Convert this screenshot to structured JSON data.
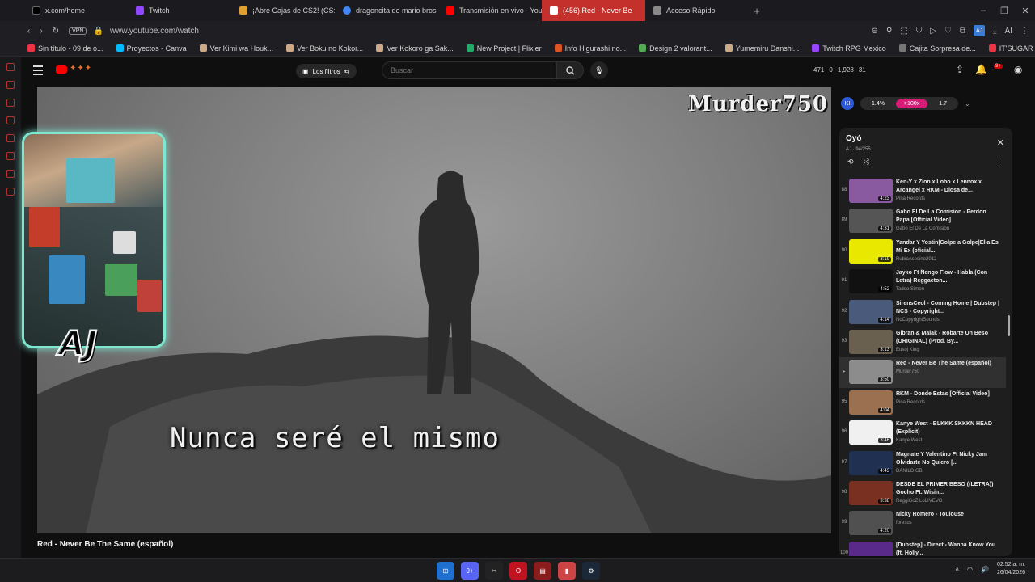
{
  "browser": {
    "tabs": [
      {
        "label": "x.com/home",
        "color": "#000000"
      },
      {
        "label": "Twitch",
        "color": "#9146ff"
      },
      {
        "label": "¡Abre Cajas de CS2! (CS:G",
        "color": "#e0a030"
      },
      {
        "label": "dragoncita de mario bros",
        "color": "#4285f4"
      },
      {
        "label": "Transmisión en vivo - You",
        "color": "#ff0000"
      },
      {
        "label": "(456) Red - Never Be",
        "color": "#ff0000"
      },
      {
        "label": "Acceso Rápido",
        "color": "#888888"
      }
    ],
    "new_tab": "+",
    "url": "www.youtube.com/watch",
    "vpn": "VPN",
    "profile_initials": "AJ",
    "ai_label": "AI",
    "bookmarks": [
      "Sin título - 09 de o...",
      "Proyectos - Canva",
      "Ver Kimi wa Houk...",
      "Ver Boku no Kokor...",
      "Ver Kokoro ga Sak...",
      "New Project | Flixier",
      "Info Higurashi no...",
      "Design 2 valorant...",
      "Yumemiru Danshi...",
      "Twitch RPG Mexico",
      "Cajita Sorpresa de...",
      "IT'SUGAR | Giant..."
    ]
  },
  "youtube": {
    "filter_label": "Los filtros",
    "search_placeholder": "Buscar",
    "stats": {
      "a": "471",
      "b": "0",
      "c": "1,928",
      "d": "31"
    },
    "notif_count": "9+",
    "video": {
      "title": "Red - Never Be The Same (español)",
      "watermark": "Murder750",
      "subtitle": "Nunca seré el mismo",
      "cam_label": "AJ"
    },
    "ext": {
      "logo": "KI",
      "v1": "1.4%",
      "v2": ">100x",
      "v3": "1.7"
    },
    "playlist": {
      "title": "Oyó",
      "subtitle": "AJ · 94/255",
      "items": [
        {
          "index": "88",
          "name": "Ken-Y x Zion x Lobo x Lennox x Arcangel x RKM - Diosa de...",
          "channel": "Pina Records",
          "duration": "4:23",
          "color": "#8a5aa0"
        },
        {
          "index": "89",
          "name": "Gabo El De La Comision - Perdon Papa [Official Video]",
          "channel": "Gabo El De La Comision",
          "duration": "4:31",
          "color": "#555555"
        },
        {
          "index": "90",
          "name": "Yandar Y Yostin|Golpe a Golpe|Ella Es Mi Ex (oficial...",
          "channel": "RubioAsesino2012",
          "duration": "3:19",
          "color": "#e8e800"
        },
        {
          "index": "91",
          "name": "Jayko Ft Ñengo Flow - Habla (Con Letra) Reggaeton...",
          "channel": "Tadeo Simon",
          "duration": "4:52",
          "color": "#111111"
        },
        {
          "index": "92",
          "name": "SirensCeol - Coming Home | Dubstep | NCS - Copyright...",
          "channel": "NoCopyrightSounds",
          "duration": "4:14",
          "color": "#4a5a7a"
        },
        {
          "index": "93",
          "name": "Gibran & Malak - Robarte Un Beso (ORIGINAL) (Prod. By...",
          "channel": "Eusoj King",
          "duration": "3:13",
          "color": "#6a6050"
        },
        {
          "index": "▸",
          "name": "Red - Never Be The Same (español)",
          "channel": "Murder750",
          "duration": "3:50",
          "color": "#8c8c8c"
        },
        {
          "index": "95",
          "name": "RKM - Donde Estas [Official Video]",
          "channel": "Pina Records",
          "duration": "4:04",
          "color": "#9a7050"
        },
        {
          "index": "96",
          "name": "Kanye West - BLKKK SKKKN HEAD (Explicit)",
          "channel": "Kanye West",
          "duration": "3:46",
          "color": "#f0f0f0"
        },
        {
          "index": "97",
          "name": "Magnate Y Valentino Ft Nicky Jam Olvidarte No Quiero [...",
          "channel": "DANILO GB",
          "duration": "4:43",
          "color": "#203050"
        },
        {
          "index": "98",
          "name": "DESDE EL PRIMER BESO ((LETRA)) Gocho Ft. Wisin...",
          "channel": "ReggiGoZ.LoLIVEVO",
          "duration": "3:38",
          "color": "#7a3020"
        },
        {
          "index": "99",
          "name": "Nicky Romero - Toulouse",
          "channel": "foresus",
          "duration": "4:20",
          "color": "#505050"
        },
        {
          "index": "100",
          "name": "[Dubstep] - Direct - Wanna Know You (ft. Holly...",
          "channel": "",
          "duration": "4:21",
          "color": "#5a2a8a"
        }
      ]
    }
  },
  "taskbar": {
    "time": "02:52 a. m.",
    "date": "26/04/2026",
    "discord_badge": "9+"
  }
}
